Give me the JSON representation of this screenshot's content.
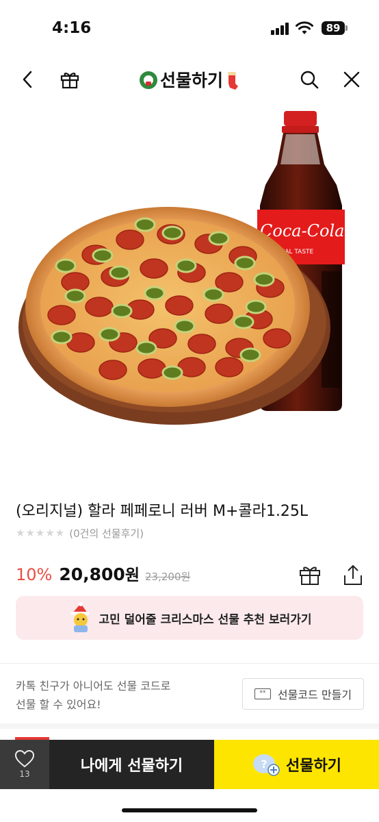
{
  "status_bar": {
    "time": "4:16",
    "battery": "89"
  },
  "header": {
    "title": "선물하기",
    "icons": [
      "back-arrow-icon",
      "gift-box-icon",
      "search-icon",
      "close-icon"
    ]
  },
  "product": {
    "name": "(오리지널) 할라 페페로니 러버 M+콜라1.25L",
    "rating_count_text": "(0건의 선물후기)",
    "discount": "10%",
    "price": "20,800",
    "currency": "원",
    "original_price": "23,200원"
  },
  "banner": {
    "text": "고민 덜어줄 크리스마스 선물 추천 보러가기"
  },
  "gift_code": {
    "info_line1": "카톡 친구가 아니어도 선물 코드로",
    "info_line2": "선물 할 수 있어요!",
    "button_label": "선물코드 만들기",
    "button_icon_text": "**"
  },
  "bottom_bar": {
    "wish_count": "13",
    "self_gift_label": "나에게 선물하기",
    "gift_label": "선물하기",
    "gift_icon_text": "?"
  },
  "colors": {
    "accent_yellow": "#fee500",
    "discount_red": "#e94e43",
    "banner_pink": "#fbe9ec",
    "dark_button": "#242424"
  }
}
